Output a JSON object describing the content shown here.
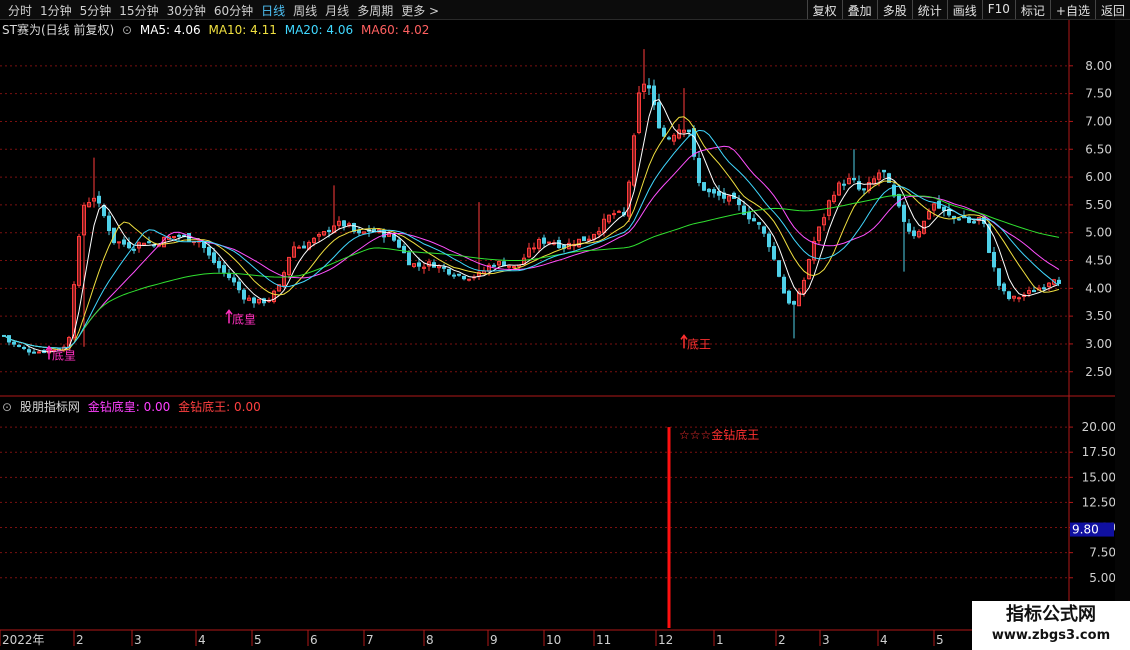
{
  "toolbar": {
    "periods": [
      "分时",
      "1分钟",
      "5分钟",
      "15分钟",
      "30分钟",
      "60分钟",
      "日线",
      "周线",
      "月线",
      "多周期",
      "更多 >"
    ],
    "active": "日线",
    "actions": [
      "复权",
      "叠加",
      "多股",
      "统计",
      "画线",
      "F10",
      "标记",
      "+自选",
      "返回"
    ]
  },
  "main_legend": {
    "title": "ST赛为(日线 前复权)",
    "ma5": "MA5: 4.06",
    "ma10": "MA10: 4.11",
    "ma20": "MA20: 4.06",
    "ma60": "MA60: 4.02"
  },
  "sub_legend": {
    "title": "股朋指标网",
    "item1": "金钻底皇: 0.00",
    "item2": "金钻底王: 0.00"
  },
  "watermark": {
    "line1": "指标公式网",
    "line2": "www.zbgs3.com"
  },
  "colors": {
    "up": "#ff3b3b",
    "down": "#4fd0e8",
    "ma5": "#ffffff",
    "ma10": "#f0e040",
    "ma20": "#ff50ff",
    "ma60": "#30e030",
    "grid": "#7a1010",
    "axis": "#b01818",
    "signal_huang": "#ff30c0",
    "signal_wang": "#ff3030"
  },
  "chart_data": [
    {
      "type": "candlestick",
      "ylim": [
        2.1,
        8.5
      ],
      "yticks": [
        2.5,
        3.0,
        3.5,
        4.0,
        4.5,
        5.0,
        5.5,
        6.0,
        6.5,
        7.0,
        7.5,
        8.0
      ],
      "x_labels": [
        "2022年",
        "2",
        "3",
        "4",
        "5",
        "6",
        "7",
        "8",
        "9",
        "10",
        "11",
        "12",
        "1",
        "2",
        "3",
        "4",
        "5"
      ],
      "close_path": [
        [
          0,
          3.25
        ],
        [
          8,
          3.05
        ],
        [
          18,
          2.95
        ],
        [
          28,
          2.88
        ],
        [
          40,
          2.86
        ],
        [
          55,
          2.9
        ],
        [
          68,
          2.95
        ],
        [
          76,
          4.5
        ],
        [
          84,
          5.5
        ],
        [
          94,
          5.65
        ],
        [
          104,
          5.3
        ],
        [
          114,
          4.85
        ],
        [
          124,
          4.8
        ],
        [
          134,
          4.75
        ],
        [
          144,
          4.85
        ],
        [
          154,
          4.78
        ],
        [
          166,
          4.9
        ],
        [
          178,
          4.95
        ],
        [
          190,
          4.9
        ],
        [
          200,
          4.85
        ],
        [
          210,
          4.55
        ],
        [
          220,
          4.35
        ],
        [
          232,
          4.15
        ],
        [
          244,
          3.85
        ],
        [
          256,
          3.75
        ],
        [
          268,
          3.78
        ],
        [
          280,
          4.05
        ],
        [
          292,
          4.75
        ],
        [
          302,
          4.75
        ],
        [
          312,
          4.85
        ],
        [
          322,
          4.95
        ],
        [
          334,
          5.15
        ],
        [
          346,
          5.15
        ],
        [
          358,
          4.95
        ],
        [
          370,
          5.05
        ],
        [
          380,
          5.0
        ],
        [
          390,
          4.95
        ],
        [
          400,
          4.75
        ],
        [
          410,
          4.45
        ],
        [
          420,
          4.4
        ],
        [
          432,
          4.45
        ],
        [
          444,
          4.35
        ],
        [
          456,
          4.25
        ],
        [
          468,
          4.2
        ],
        [
          480,
          4.25
        ],
        [
          492,
          4.45
        ],
        [
          504,
          4.45
        ],
        [
          516,
          4.35
        ],
        [
          528,
          4.65
        ],
        [
          540,
          4.85
        ],
        [
          552,
          4.85
        ],
        [
          564,
          4.75
        ],
        [
          576,
          4.85
        ],
        [
          588,
          4.9
        ],
        [
          600,
          5.1
        ],
        [
          612,
          5.35
        ],
        [
          624,
          5.3
        ],
        [
          632,
          6.3
        ],
        [
          638,
          7.4
        ],
        [
          646,
          7.8
        ],
        [
          656,
          7.1
        ],
        [
          666,
          6.65
        ],
        [
          676,
          6.85
        ],
        [
          688,
          6.95
        ],
        [
          698,
          5.9
        ],
        [
          710,
          5.7
        ],
        [
          722,
          5.65
        ],
        [
          734,
          5.55
        ],
        [
          746,
          5.35
        ],
        [
          758,
          5.15
        ],
        [
          768,
          4.85
        ],
        [
          778,
          4.3
        ],
        [
          786,
          3.8
        ],
        [
          794,
          3.7
        ],
        [
          802,
          4.0
        ],
        [
          812,
          4.75
        ],
        [
          822,
          5.2
        ],
        [
          832,
          5.7
        ],
        [
          842,
          5.9
        ],
        [
          852,
          5.95
        ],
        [
          862,
          5.7
        ],
        [
          872,
          5.9
        ],
        [
          882,
          6.15
        ],
        [
          892,
          5.7
        ],
        [
          902,
          5.3
        ],
        [
          912,
          4.95
        ],
        [
          922,
          5.1
        ],
        [
          932,
          5.55
        ],
        [
          942,
          5.4
        ],
        [
          952,
          5.25
        ],
        [
          962,
          5.3
        ],
        [
          972,
          5.15
        ],
        [
          982,
          5.3
        ],
        [
          990,
          4.6
        ],
        [
          1000,
          4.0
        ],
        [
          1010,
          3.8
        ],
        [
          1020,
          3.85
        ],
        [
          1032,
          3.95
        ],
        [
          1044,
          4.05
        ],
        [
          1054,
          4.2
        ],
        [
          1066,
          4.05
        ]
      ],
      "ma_series": [
        {
          "name": "MA5",
          "period": 5
        },
        {
          "name": "MA10",
          "period": 10
        },
        {
          "name": "MA20",
          "period": 20
        },
        {
          "name": "MA60",
          "period": 60
        }
      ],
      "annotations": [
        {
          "text": "底皇",
          "date_index": 5,
          "price": 2.9
        },
        {
          "text": "底皇",
          "date_index": 41,
          "price": 3.55
        },
        {
          "text": "底王",
          "date_index": 132,
          "price": 3.1
        }
      ]
    },
    {
      "type": "bar",
      "ylim": [
        0,
        22
      ],
      "yticks": [
        5.0,
        7.5,
        10.0,
        12.5,
        15.0,
        17.5,
        20.0
      ],
      "marker_value": "9.80",
      "signal": {
        "date_index": 132,
        "value": 20,
        "label": "☆☆☆金钻底王"
      }
    }
  ]
}
